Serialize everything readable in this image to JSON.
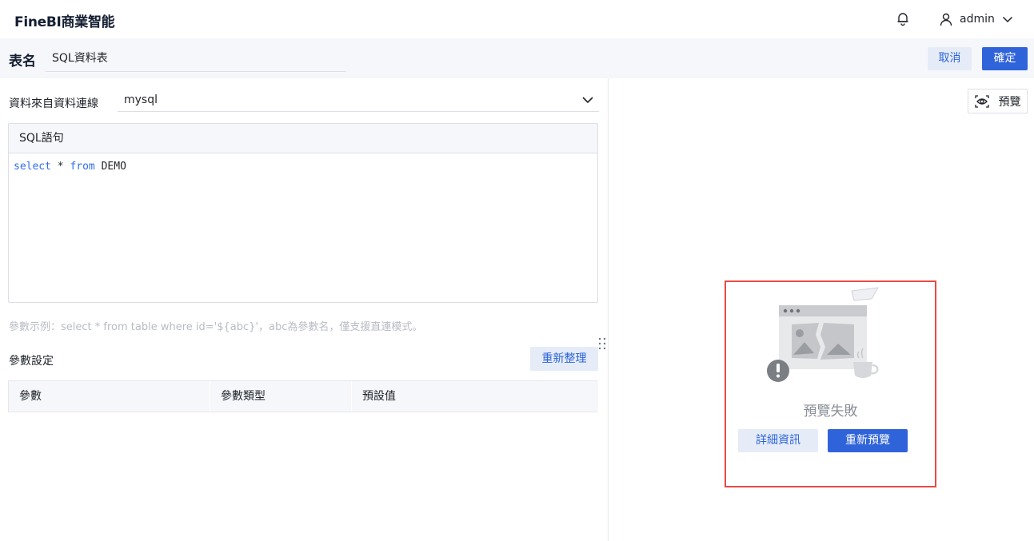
{
  "app": {
    "brand": "FineBI商業智能"
  },
  "header": {
    "username": "admin",
    "icons": [
      "bell-icon",
      "user-icon",
      "chevron-down-icon"
    ]
  },
  "title_row": {
    "label": "表名",
    "table_name": "SQL資料表",
    "cancel_label": "取消",
    "confirm_label": "確定"
  },
  "source": {
    "label": "資料來自資料連線",
    "selected": "mysql"
  },
  "sql": {
    "header": "SQL語句",
    "kw_select": "select",
    "star": " * ",
    "kw_from": "from",
    "table": " DEMO"
  },
  "hint": "參數示例：select * from table where id='${abc}'，abc為參數名，僅支援直連模式。",
  "params": {
    "title": "參數設定",
    "refresh_label": "重新整理",
    "columns": [
      "參數",
      "參數類型",
      "預設值"
    ]
  },
  "preview": {
    "button_label": "預覽",
    "error_text": "預覽失敗",
    "detail_label": "詳細資訊",
    "retry_label": "重新預覽"
  },
  "colors": {
    "primary": "#2f63da",
    "light": "#e6ecf7",
    "error_border": "#e94a46"
  }
}
